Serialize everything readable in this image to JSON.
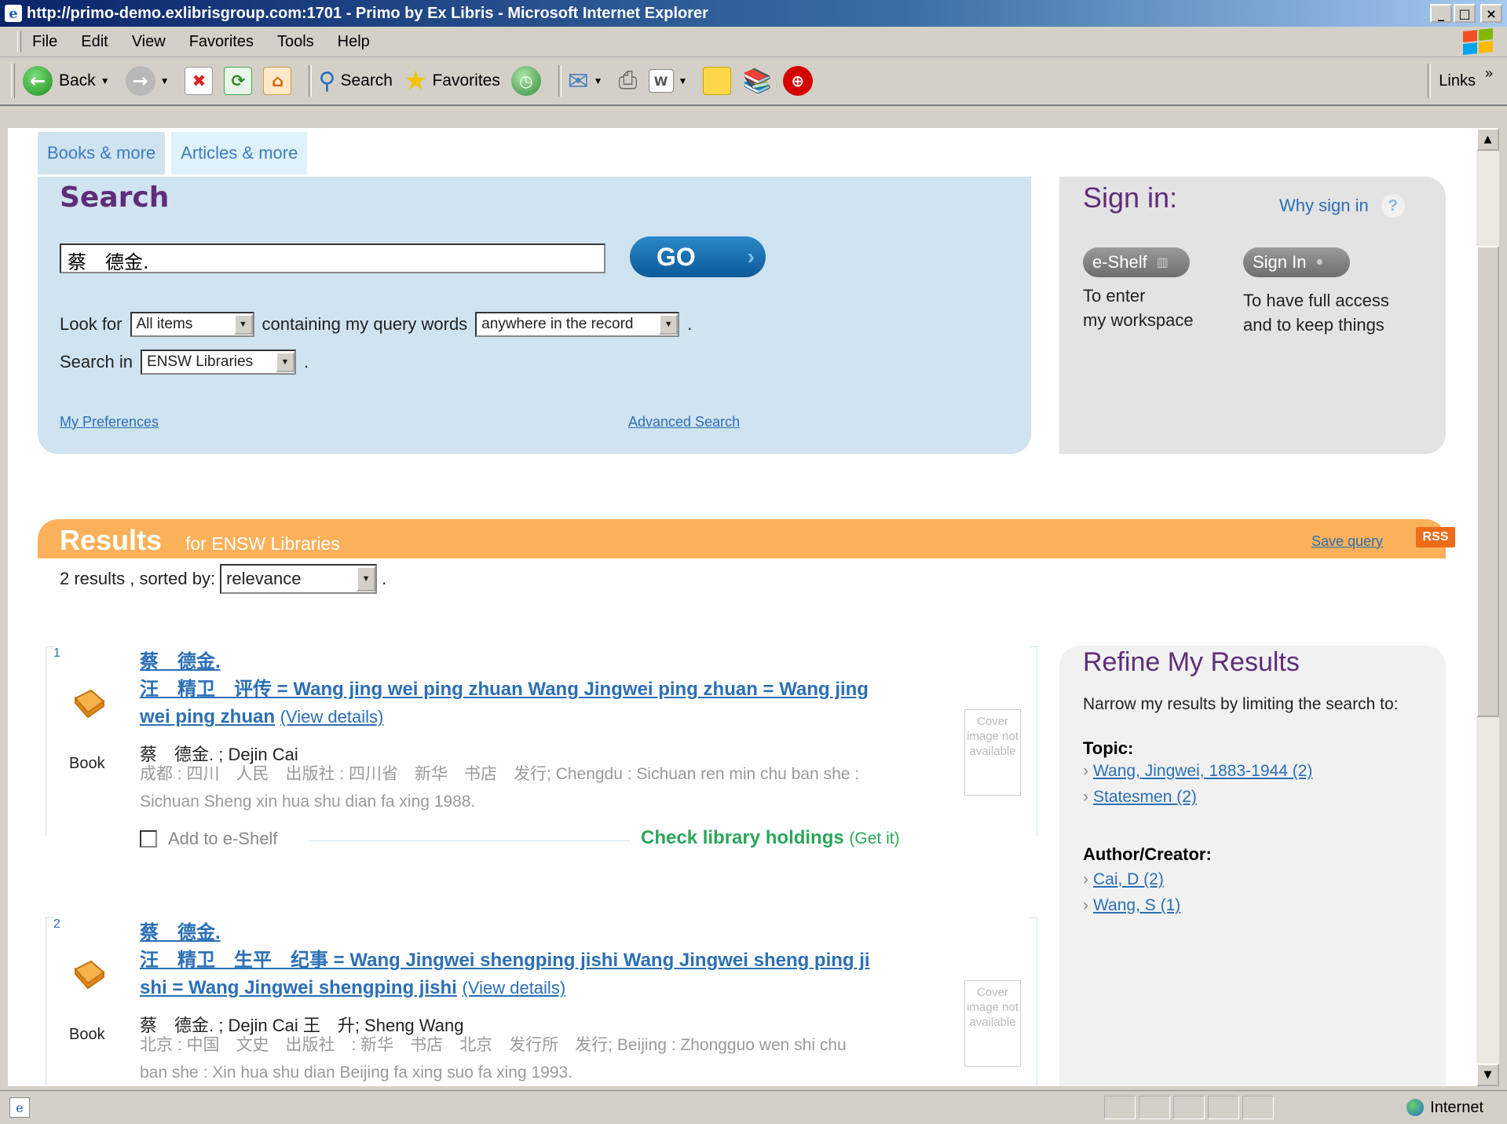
{
  "window": {
    "title": "http://primo-demo.exlibrisgroup.com:1701 - Primo by Ex Libris - Microsoft Internet Explorer",
    "minimize": "_",
    "maximize": "□",
    "close": "×"
  },
  "menu": [
    "File",
    "Edit",
    "View",
    "Favorites",
    "Tools",
    "Help"
  ],
  "toolbar": {
    "back_label": "Back",
    "search_label": "Search",
    "favorites_label": "Favorites",
    "links_label": "Links",
    "links_chevron": "»"
  },
  "tabs": [
    "Books & more",
    "Articles & more"
  ],
  "search": {
    "heading": "Search",
    "query": "蔡　德金.",
    "go_label": "GO",
    "look_for_label": "Look for",
    "look_for_value": "All items",
    "containing_label": "containing my query words",
    "scope_value": "anywhere in the record",
    "search_in_label": "Search in",
    "search_in_value": "ENSW Libraries",
    "preferences_link": "My Preferences",
    "advanced_link": "Advanced Search"
  },
  "signin": {
    "heading": "Sign in:",
    "why_link": "Why sign in",
    "help": "?",
    "eshelf_button": "e-Shelf",
    "eshelf_text_1": "To enter",
    "eshelf_text_2": "my workspace",
    "signin_button": "Sign In",
    "signin_text_1": "To have full access",
    "signin_text_2": "and to keep things"
  },
  "results": {
    "heading": "Results",
    "for_text": "for  ENSW Libraries",
    "save_query": "Save query",
    "rss": "RSS",
    "count_text": "2 results , sorted by:",
    "sort_value": "relevance"
  },
  "items": [
    {
      "num": "1",
      "type": "Book",
      "title_line1": "蔡　德金.",
      "title_line2": "汪　精卫　评传 = Wang jing wei ping zhuan Wang Jingwei ping zhuan = Wang jing",
      "title_line3": "wei ping zhuan",
      "view_details": "(View details)",
      "authors": "蔡　德金. ; Dejin Cai",
      "pub_line1": "成都 : 四川　人民　出版社 : 四川省　新华　书店　发行; Chengdu : Sichuan ren min chu ban she :",
      "pub_line2": "Sichuan Sheng xin hua shu dian fa xing 1988.",
      "cover": "Cover image not available",
      "add_eshelf": "Add to e-Shelf",
      "holdings": "Check library holdings",
      "get_it": "(Get it)"
    },
    {
      "num": "2",
      "type": "Book",
      "title_line1": "蔡　德金.",
      "title_line2": "汪　精卫　生平　纪事 = Wang Jingwei shengping jishi Wang Jingwei sheng ping ji",
      "title_line3": "shi = Wang Jingwei shengping jishi",
      "view_details": "(View details)",
      "authors": "蔡　德金. ; Dejin Cai 王　升; Sheng Wang",
      "pub_line1": "北京 : 中国　文史　出版社　: 新华　书店　北京　发行所　发行; Beijing : Zhongguo wen shi chu",
      "pub_line2": "ban she : Xin hua shu dian Beijing fa xing suo fa xing 1993.",
      "cover": "Cover image not available"
    }
  ],
  "refine": {
    "heading": "Refine My Results",
    "description": "Narrow my results by limiting the search to:",
    "topic_heading": "Topic:",
    "topics": [
      "Wang, Jingwei, 1883-1944 (2)",
      "Statesmen (2)"
    ],
    "author_heading": "Author/Creator:",
    "authors": [
      "Cai, D (2)",
      "Wang, S (1)"
    ]
  },
  "status": {
    "zone": "Internet"
  }
}
